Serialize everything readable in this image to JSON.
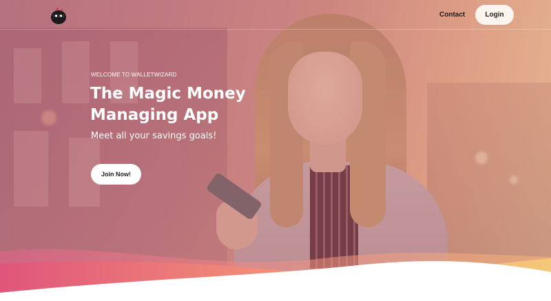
{
  "header": {
    "logo": "ninja-mascot-logo",
    "nav": {
      "contact_label": "Contact",
      "login_label": "Login"
    }
  },
  "hero": {
    "eyebrow": "WELCOME TO WALLETWIZARD",
    "headline_line1": "The Magic Money",
    "headline_line2": "Managing App",
    "subheadline": "Meet all your savings goals!",
    "cta_label": "Join Now!"
  },
  "theme": {
    "overlay_color": "#c46e82",
    "wave_gradient": [
      "#e0557a",
      "#f08a78",
      "#f6b07a",
      "#f5c879"
    ],
    "button_bg": "#ffffff"
  }
}
